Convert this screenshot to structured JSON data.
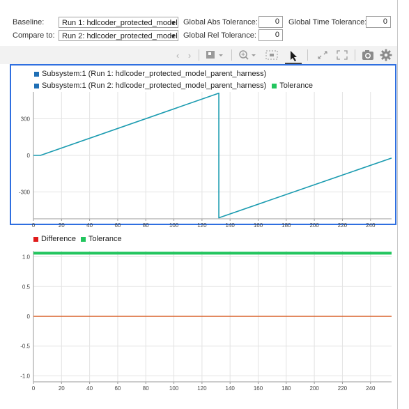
{
  "header": {
    "baseline_label": "Baseline:",
    "baseline_value": "Run 1: hdlcoder_protected_model",
    "compare_label": "Compare to:",
    "compare_value": "Run 2: hdlcoder_protected_model",
    "abs_tol_label": "Global Abs Tolerance:",
    "abs_tol_value": "0",
    "rel_tol_label": "Global Rel Tolerance:",
    "rel_tol_value": "0",
    "time_tol_label": "Global Time Tolerance:",
    "time_tol_value": "0"
  },
  "toolbar": {
    "icons": [
      "back-icon",
      "forward-icon",
      "layout-icon",
      "zoom-icon",
      "fit-icon",
      "cursor-icon",
      "expand-icon",
      "fullscreen-icon",
      "camera-icon",
      "gear-icon"
    ]
  },
  "colors": {
    "signal": "#1f6fb5",
    "signal2": "#1a9bb0",
    "tolerance": "#22c55e",
    "difference": "#e01b1b",
    "diffline": "#d9622b",
    "panel_border": "#2f6fe0"
  },
  "chart_data": [
    {
      "type": "line",
      "legend": [
        {
          "name": "Subsystem:1 (Run 1: hdlcoder_protected_model_parent_harness)",
          "color": "#1f6fb5"
        },
        {
          "name": "Subsystem:1 (Run 2: hdlcoder_protected_model_parent_harness)",
          "color": "#1f6fb5"
        },
        {
          "name": "Tolerance",
          "color": "#22c55e"
        }
      ],
      "xlim": [
        0,
        255
      ],
      "ylim": [
        -520,
        520
      ],
      "xticks": [
        "0",
        "20",
        "40",
        "60",
        "80",
        "100",
        "120",
        "140",
        "160",
        "180",
        "200",
        "220",
        "240"
      ],
      "yticks": [
        "300",
        "0",
        "-300"
      ],
      "series": [
        {
          "name": "Subsystem:1 (Run 1: hdlcoder_protected_model_parent_harness)",
          "x": [
            0,
            5,
            132,
            132,
            255
          ],
          "y": [
            0,
            0,
            510,
            -512,
            -22
          ]
        }
      ]
    },
    {
      "type": "line",
      "legend": [
        {
          "name": "Difference",
          "color": "#e01b1b"
        },
        {
          "name": "Tolerance",
          "color": "#22c55e"
        }
      ],
      "xlim": [
        0,
        255
      ],
      "ylim": [
        -1.1,
        1.1
      ],
      "xticks": [
        "0",
        "20",
        "40",
        "60",
        "80",
        "100",
        "120",
        "140",
        "160",
        "180",
        "200",
        "220",
        "240"
      ],
      "yticks": [
        "1.0",
        "0.5",
        "0",
        "-0.5",
        "-1.0"
      ],
      "series": [
        {
          "name": "Difference",
          "x": [
            0,
            255
          ],
          "y": [
            0,
            0
          ]
        },
        {
          "name": "Tolerance",
          "x": [
            0,
            255
          ],
          "y": [
            1.06,
            1.06
          ]
        }
      ]
    }
  ]
}
